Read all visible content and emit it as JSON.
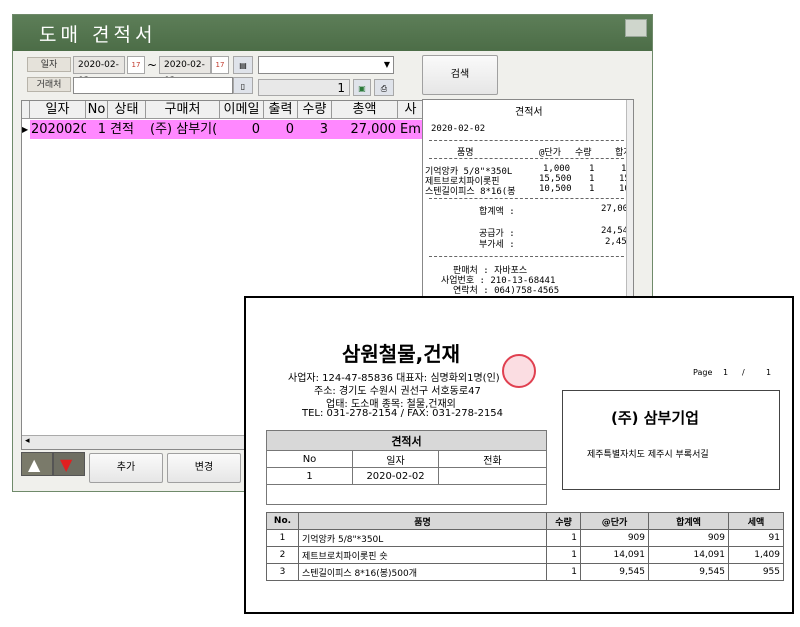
{
  "window": {
    "title": "도매 견적서",
    "date_label": "일자",
    "partner_label": "거래처",
    "date_from": "2020-02-02",
    "date_tilde": "~",
    "date_to": "2020-02-02",
    "cal_icon_text": "17",
    "page_value": "1",
    "search_button": "검색",
    "add_button": "추가",
    "edit_button": "변경"
  },
  "grid": {
    "columns": [
      "일자",
      "No",
      "상태",
      "구매처",
      "이메일",
      "출력",
      "수량",
      "총액",
      "사"
    ],
    "rows": [
      {
        "date": "2020020",
        "no": "1",
        "status": "견적",
        "buyer": "(주) 삼부기(",
        "email": "0",
        "printed": "0",
        "qty": "3",
        "total": "27,000",
        "extra": "Emp"
      }
    ]
  },
  "preview": {
    "heading": "견적서",
    "date": "2020-02-02",
    "col_item": "품명",
    "col_price": "@단가",
    "col_qty": "수량",
    "col_total": "합계",
    "lines": [
      {
        "name": "기억앙카 5/8\"*350L",
        "price": "1,000",
        "qty": "1",
        "total": "1"
      },
      {
        "name": "제트브로치파이롯핀",
        "price": "15,500",
        "qty": "1",
        "total": "15"
      },
      {
        "name": "스텐길이피스 8*16(봉",
        "price": "10,500",
        "qty": "1",
        "total": "10"
      }
    ],
    "sum_label": "합계액 :",
    "sum_value": "27,00",
    "supply_label": "공급가 :",
    "supply_value": "24,54",
    "vat_label": "부가세 :",
    "vat_value": "2,45",
    "seller": "판매처 : 자바포스",
    "biz_no": "사업번호 : 210-13-68441",
    "contact": "연락처 : 064)758-4565"
  },
  "document": {
    "company": "삼원철물,건재",
    "biz_line": "사업자: 124-47-85836  대표자: 심명화외1명(인)",
    "addr_line": "주소: 경기도 수원시 권선구 서호동로47",
    "type_line": "업태: 도소매  종목: 철물,건재외",
    "tel_line": "TEL: 031-278-2154 / FAX: 031-278-2154",
    "page_label": "Page",
    "page_no": "1",
    "page_sep": "/",
    "page_total": "1",
    "customer": "(주) 삼부기업",
    "customer_addr": "제주특별자치도 제주시 부록서길",
    "est_title": "견적서",
    "est_headers": [
      "No",
      "일자",
      "전화"
    ],
    "est_values": [
      "1",
      "2020-02-02",
      ""
    ],
    "item_headers": [
      "No.",
      "품명",
      "수량",
      "@단가",
      "합계액",
      "세액"
    ],
    "items": [
      {
        "no": "1",
        "name": "기억앙카 5/8\"*350L",
        "qty": "1",
        "price": "909",
        "amount": "909",
        "tax": "91"
      },
      {
        "no": "2",
        "name": "제트브로치파이롯핀 숏",
        "qty": "1",
        "price": "14,091",
        "amount": "14,091",
        "tax": "1,409"
      },
      {
        "no": "3",
        "name": "스텐길이피스 8*16(봉)500개",
        "qty": "1",
        "price": "9,545",
        "amount": "9,545",
        "tax": "955"
      }
    ]
  }
}
